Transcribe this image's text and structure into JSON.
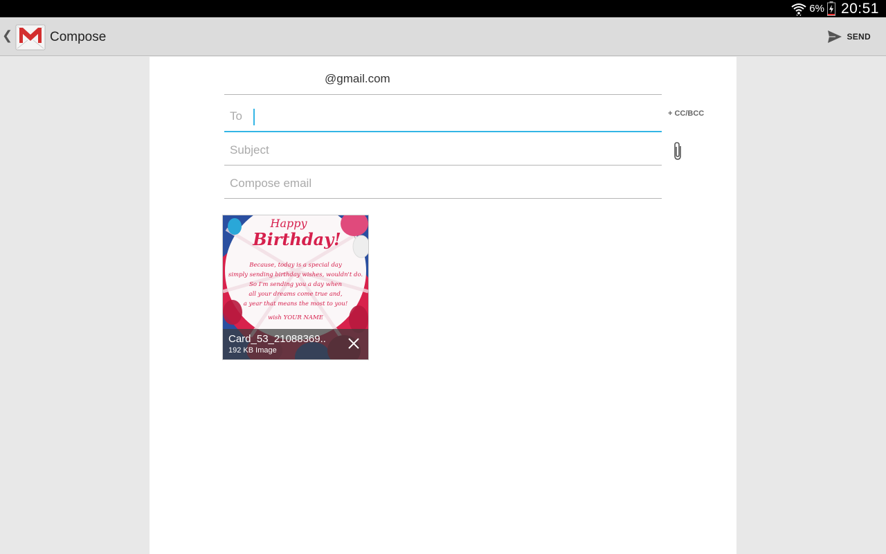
{
  "status_bar": {
    "battery": "6%",
    "time": "20:51"
  },
  "action_bar": {
    "title": "Compose",
    "send_label": "SEND"
  },
  "compose": {
    "from": "@gmail.com",
    "to_placeholder": "To",
    "cc_bcc_label": "+ CC/BCC",
    "subject_placeholder": "Subject",
    "body_placeholder": "Compose email"
  },
  "attachment": {
    "name": "Card_53_21088369..",
    "size": "192 KB Image",
    "card": {
      "happy": "Happy",
      "birthday": "Birthday!",
      "lines": [
        "Because, today is a special day",
        "simply sending birthday wishes, wouldn't do.",
        "So I'm sending you a day when",
        "all your dreams come true and,",
        "a year that means the most to you!"
      ],
      "signoff": "wish YOUR NAME"
    }
  },
  "colors": {
    "accent": "#33b5e5",
    "card_red": "#d6204d",
    "card_pink": "#e0407a"
  }
}
